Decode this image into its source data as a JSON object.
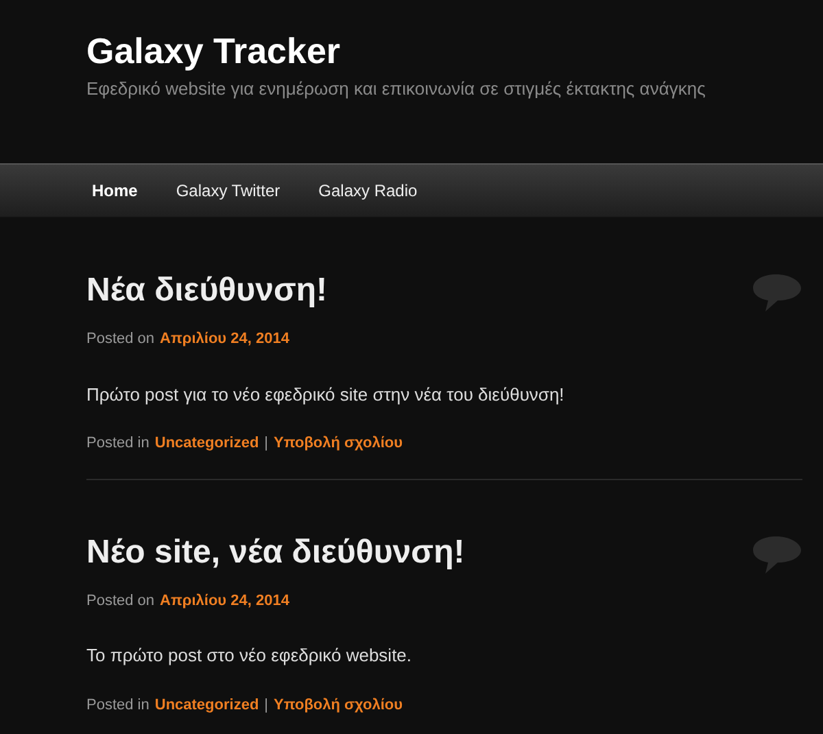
{
  "site": {
    "title": "Galaxy Tracker",
    "tagline": "Εφεδρικό website για ενημέρωση και επικοινωνία σε στιγμές έκτακτης ανάγκης"
  },
  "nav": [
    {
      "label": "Home",
      "selected": true
    },
    {
      "label": "Galaxy Twitter",
      "selected": false
    },
    {
      "label": "Galaxy Radio",
      "selected": false
    }
  ],
  "posts": [
    {
      "title": "Νέα διεύθυνση!",
      "posted_on_label": "Posted on",
      "date": "Απριλίου 24, 2014",
      "body": "Πρώτο post για το νέο εφεδρικό site στην νέα του διεύθυνση!",
      "posted_in_label": "Posted in",
      "category": "Uncategorized",
      "separator": "|",
      "comment_link": "Υποβολή σχολίου"
    },
    {
      "title": "Νέο site, νέα διεύθυνση!",
      "posted_on_label": "Posted on",
      "date": "Απριλίου 24, 2014",
      "body": "Το πρώτο post στο νέο εφεδρικό website.",
      "posted_in_label": "Posted in",
      "category": "Uncategorized",
      "separator": "|",
      "comment_link": "Υποβολή σχολίου"
    }
  ]
}
